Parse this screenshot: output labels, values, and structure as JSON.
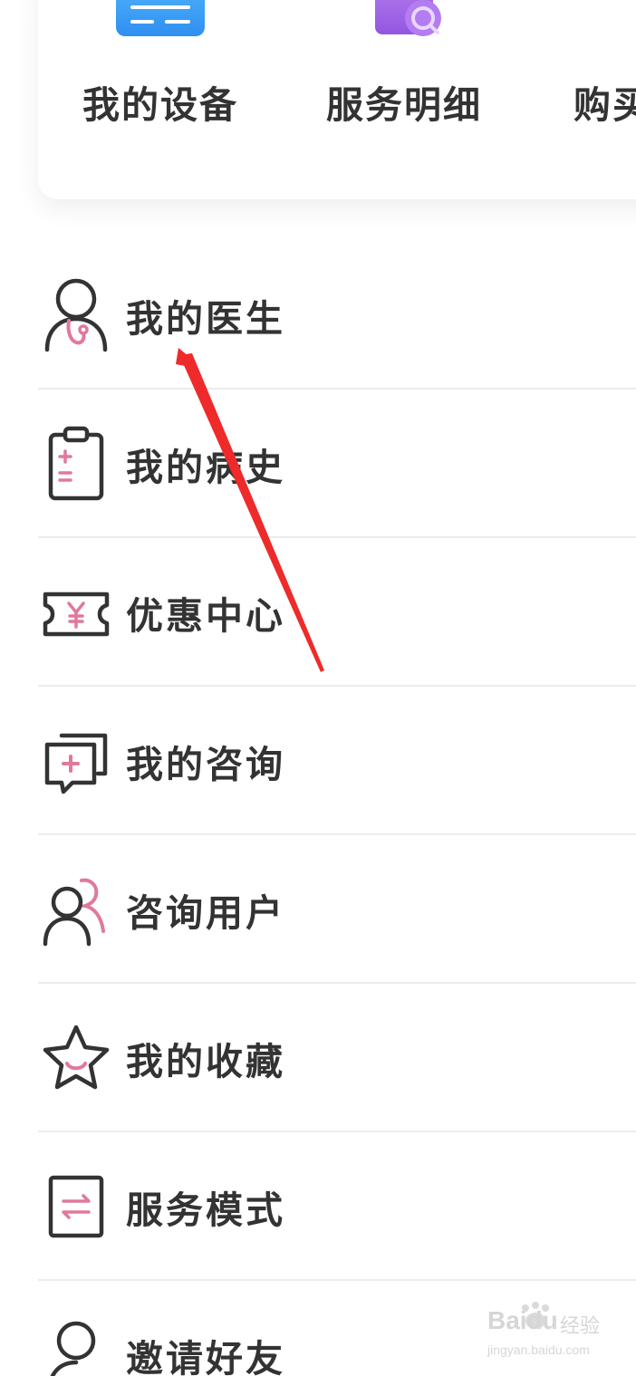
{
  "shortcuts": [
    {
      "label": "我的设备",
      "icon": "device-monitor-icon"
    },
    {
      "label": "服务明细",
      "icon": "document-search-icon"
    },
    {
      "label": "购买",
      "icon": "alert-icon"
    }
  ],
  "menu": {
    "items": [
      {
        "label": "我的医生",
        "icon": "doctor-icon"
      },
      {
        "label": "我的病史",
        "icon": "clipboard-icon"
      },
      {
        "label": "优惠中心",
        "icon": "coupon-icon"
      },
      {
        "label": "我的咨询",
        "icon": "consult-chat-icon"
      },
      {
        "label": "咨询用户",
        "icon": "users-icon"
      },
      {
        "label": "我的收藏",
        "icon": "star-icon"
      },
      {
        "label": "服务模式",
        "icon": "switch-mode-icon"
      },
      {
        "label": "邀请好友",
        "icon": "invite-user-icon"
      }
    ]
  },
  "watermark": {
    "brand": "Baidu",
    "cn": "经验",
    "url": "jingyan.baidu.com"
  },
  "colors": {
    "accent_pink": "#e0799c",
    "icon_stroke": "#333333",
    "device_blue": "#3aa3f5",
    "doc_purple": "#a56ce6",
    "alert_red": "#f2556b",
    "arrow_red": "#ee2a2a"
  }
}
